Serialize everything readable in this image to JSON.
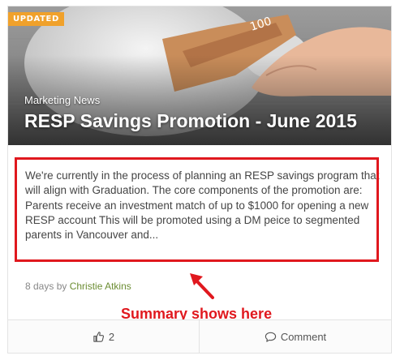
{
  "card": {
    "badge": "UPDATED",
    "category": "Marketing News",
    "title": "RESP Savings Promotion - June 2015",
    "summary": "We're currently in the process of planning an RESP savings program that will align with Graduation. The core components of the promotion are: Parents receive an investment match of up to $1000 for opening a new RESP account This will be promoted using a DM peice to segmented parents in Vancouver and...",
    "meta": {
      "age": "8 days by",
      "author": "Christie Atkins"
    },
    "actions": {
      "like_count": "2",
      "comment_label": "Comment"
    },
    "banknote_text": "100"
  },
  "annotation": {
    "text": "Summary shows here",
    "color": "#e0181e"
  },
  "colors": {
    "badge": "#f0a12b",
    "author_link": "#6c8d33",
    "highlight": "#e0181e"
  }
}
